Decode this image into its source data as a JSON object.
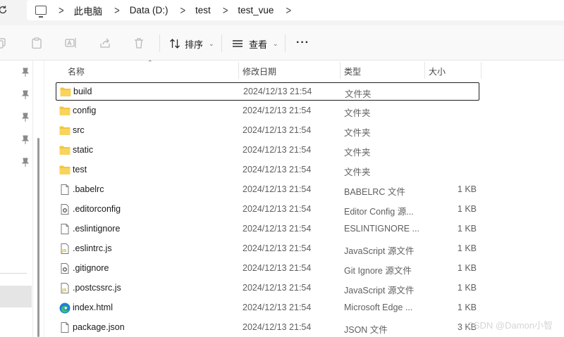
{
  "address": {
    "refresh_icon": "refresh-icon",
    "pc_icon": "this-pc-icon",
    "separator": ">",
    "crumbs": [
      "此电脑",
      "Data (D:)",
      "test",
      "test_vue"
    ]
  },
  "toolbar": {
    "sort_label": "排序",
    "view_label": "查看",
    "more": "···",
    "disabled_icons": [
      "copy-icon",
      "paste-icon",
      "rename-icon",
      "share-icon",
      "delete-icon"
    ]
  },
  "columns": {
    "name": "名称",
    "date": "修改日期",
    "type": "类型",
    "size": "大小"
  },
  "files": [
    {
      "name": "build",
      "date": "2024/12/13 21:54",
      "type": "文件夹",
      "size": "",
      "icon": "folder-icon"
    },
    {
      "name": "config",
      "date": "2024/12/13 21:54",
      "type": "文件夹",
      "size": "",
      "icon": "folder-icon"
    },
    {
      "name": "src",
      "date": "2024/12/13 21:54",
      "type": "文件夹",
      "size": "",
      "icon": "folder-icon"
    },
    {
      "name": "static",
      "date": "2024/12/13 21:54",
      "type": "文件夹",
      "size": "",
      "icon": "folder-icon"
    },
    {
      "name": "test",
      "date": "2024/12/13 21:54",
      "type": "文件夹",
      "size": "",
      "icon": "folder-icon"
    },
    {
      "name": ".babelrc",
      "date": "2024/12/13 21:54",
      "type": "BABELRC 文件",
      "size": "1 KB",
      "icon": "file-icon"
    },
    {
      "name": ".editorconfig",
      "date": "2024/12/13 21:54",
      "type": "Editor Config 源...",
      "size": "1 KB",
      "icon": "config-file-icon"
    },
    {
      "name": ".eslintignore",
      "date": "2024/12/13 21:54",
      "type": "ESLINTIGNORE ...",
      "size": "1 KB",
      "icon": "file-icon"
    },
    {
      "name": ".eslintrc.js",
      "date": "2024/12/13 21:54",
      "type": "JavaScript 源文件",
      "size": "1 KB",
      "icon": "js-file-icon"
    },
    {
      "name": ".gitignore",
      "date": "2024/12/13 21:54",
      "type": "Git Ignore 源文件",
      "size": "1 KB",
      "icon": "config-file-icon"
    },
    {
      "name": ".postcssrc.js",
      "date": "2024/12/13 21:54",
      "type": "JavaScript 源文件",
      "size": "1 KB",
      "icon": "js-file-icon"
    },
    {
      "name": "index.html",
      "date": "2024/12/13 21:54",
      "type": "Microsoft Edge ...",
      "size": "1 KB",
      "icon": "edge-icon"
    },
    {
      "name": "package.json",
      "date": "2024/12/13 21:54",
      "type": "JSON 文件",
      "size": "3 KB",
      "icon": "file-icon"
    }
  ],
  "watermark": "CSDN @Damon小智",
  "colors": {
    "folder": "#f4c542",
    "focus_border": "#1f1f1f",
    "js_badge": "#c8b32a",
    "edge_blue": "#1e7fd6",
    "edge_green": "#3cc06e"
  }
}
